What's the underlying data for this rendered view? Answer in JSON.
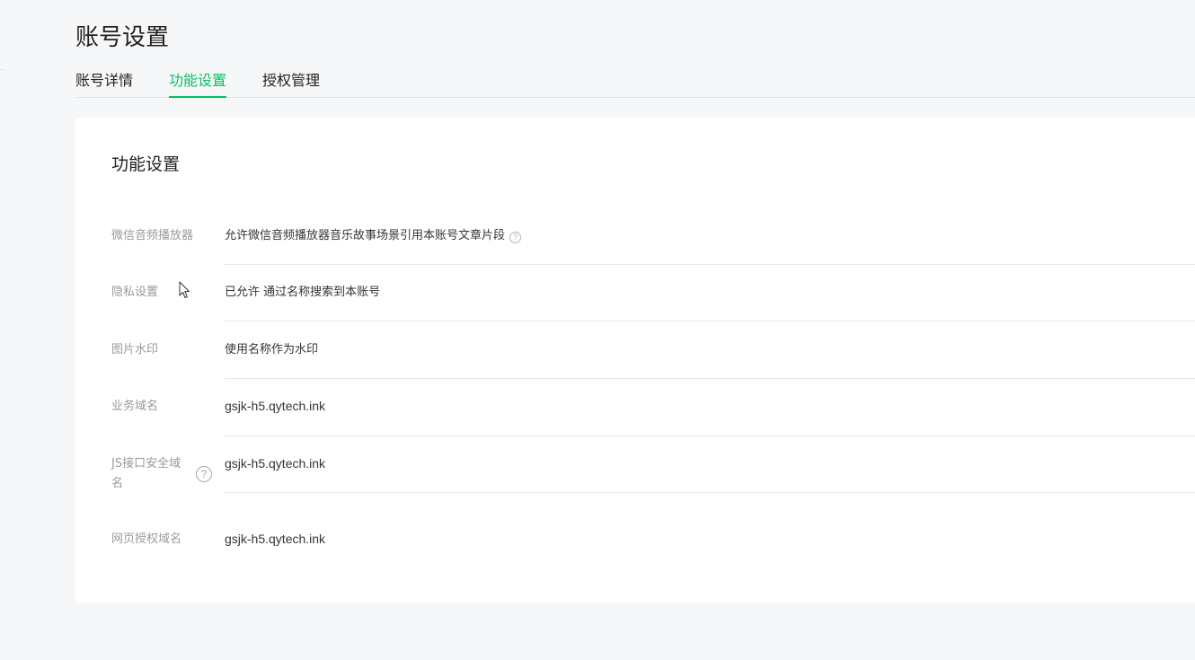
{
  "page": {
    "title": "账号设置"
  },
  "tabs": [
    {
      "label": "账号详情",
      "active": false
    },
    {
      "label": "功能设置",
      "active": true
    },
    {
      "label": "授权管理",
      "active": false
    }
  ],
  "card": {
    "title": "功能设置",
    "rows": [
      {
        "label": "微信音频播放器",
        "value": "允许微信音频播放器音乐故事场景引用本账号文章片段",
        "help_icon": "question-circle-icon"
      },
      {
        "label": "隐私设置",
        "value": "已允许 通过名称搜索到本账号"
      },
      {
        "label": "图片水印",
        "value": "使用名称作为水印"
      },
      {
        "label": "业务域名",
        "value": "gsjk-h5.qytech.ink"
      },
      {
        "label": "JS接口安全域名",
        "value": "gsjk-h5.qytech.ink",
        "help_icon": "question-circle-icon"
      },
      {
        "label": "网页授权域名",
        "value": "gsjk-h5.qytech.ink"
      }
    ]
  },
  "icons": {
    "help_glyph": "?",
    "cursor": "mouse-cursor-icon"
  },
  "colors": {
    "accent": "#07c160",
    "background": "#f6f7f9",
    "card": "#ffffff",
    "label": "#9a9a9a",
    "text": "#353535"
  }
}
